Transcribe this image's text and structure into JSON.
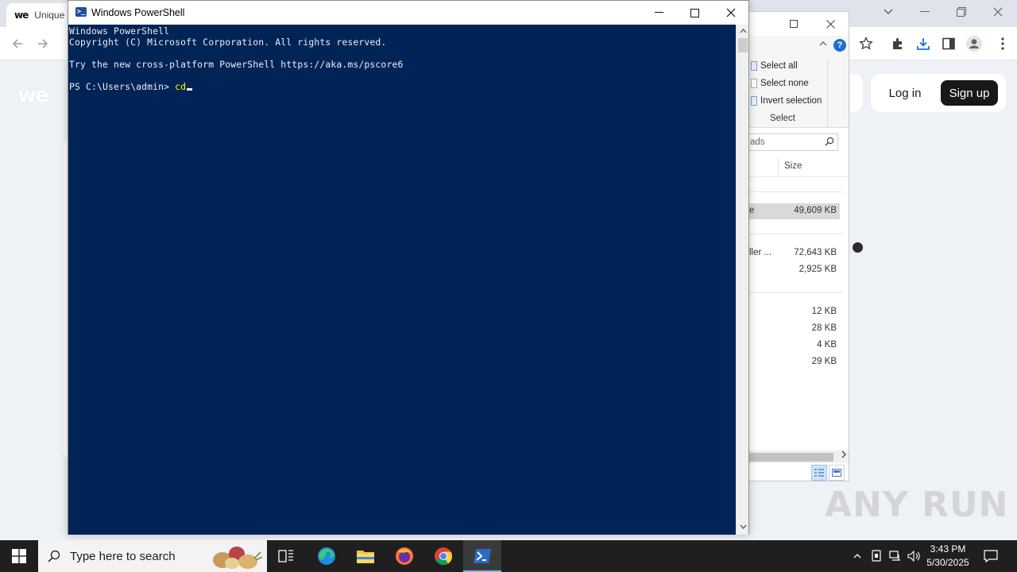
{
  "browser": {
    "tab_title": "Unique",
    "favicon_text": "we",
    "logo_text": "we",
    "login_label": "Log in",
    "signup_label": "Sign up"
  },
  "explorer": {
    "search_placeholder": "ads",
    "select_items": [
      "Select all",
      "Select none",
      "Invert selection"
    ],
    "group_label": "Select",
    "size_column": "Size",
    "help_glyph": "?",
    "rows": [
      {
        "name": "e",
        "size": "49,609 KB",
        "selected": true
      },
      {
        "name": "ller ...",
        "size": "72,643 KB",
        "selected": false
      },
      {
        "name": "",
        "size": "2,925 KB",
        "selected": false
      },
      {
        "name": "",
        "size": "12 KB",
        "selected": false
      },
      {
        "name": "",
        "size": "28 KB",
        "selected": false
      },
      {
        "name": "",
        "size": "4 KB",
        "selected": false
      },
      {
        "name": "",
        "size": "29 KB",
        "selected": false
      }
    ]
  },
  "powershell": {
    "title": "Windows PowerShell",
    "lines": [
      "Windows PowerShell",
      "Copyright (C) Microsoft Corporation. All rights reserved.",
      "",
      "Try the new cross-platform PowerShell https://aka.ms/pscore6",
      ""
    ],
    "prompt": "PS C:\\Users\\admin> ",
    "typed_command": "cd",
    "colors": {
      "background": "#012456",
      "text": "#eeedf0",
      "command": "#ffff00"
    }
  },
  "watermark": "ANY RUN",
  "taskbar": {
    "search_placeholder": "Type here to search",
    "apps": [
      "task-view",
      "edge",
      "file-explorer",
      "firefox",
      "chrome",
      "powershell"
    ],
    "active_app": "powershell",
    "clock_time": "3:43 PM",
    "clock_date": "5/30/2025"
  }
}
